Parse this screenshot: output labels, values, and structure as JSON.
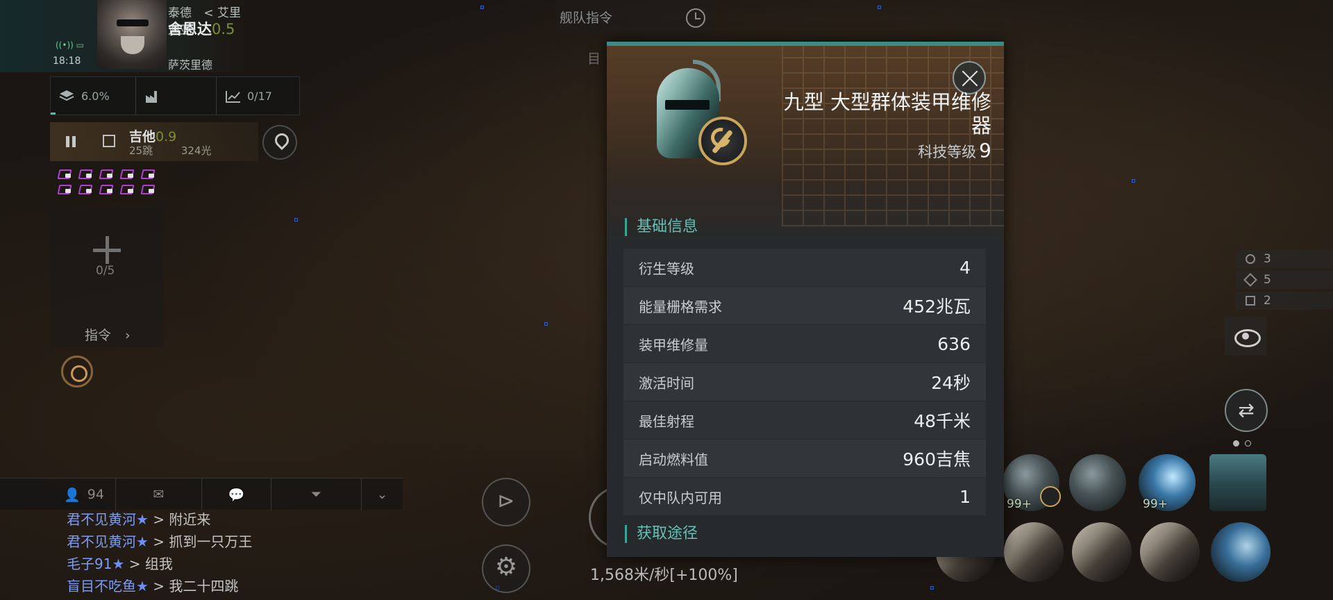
{
  "header": {
    "location_prefix": "泰德",
    "location_region": "< 艾里迪亚",
    "system_name": "舍恩达",
    "system_security": "0.5",
    "constellation": "萨茨里德",
    "clock": "18:18"
  },
  "stats": {
    "cargo_percent": "6.0%",
    "industry_progress": "0/17",
    "cargo_fill": 6.0
  },
  "route": {
    "destination": "吉他",
    "destination_security": "0.9",
    "jumps": "25跳",
    "distance": "324光"
  },
  "fleet": {
    "count": "0/5",
    "command_label": "指令"
  },
  "chat": {
    "member_count": "94",
    "messages": [
      {
        "name": "君不见黄河",
        "star": "★",
        "sep": " > ",
        "text": "附近来"
      },
      {
        "name": "君不见黄河",
        "star": "★",
        "sep": " > ",
        "text": "抓到一只万王"
      },
      {
        "name": "毛子91",
        "star": "★",
        "sep": " > ",
        "text": "组我"
      },
      {
        "name": "盲目不吃鱼",
        "star": "★",
        "sep": " > ",
        "text": "我二十四跳"
      }
    ]
  },
  "top_center": {
    "fleet_command": "舰队指令",
    "target_peek": "目"
  },
  "modal": {
    "title_line1": "九型 大型群体装甲维修",
    "title_line2": "器",
    "tech_label": "科技等级",
    "tech_value": "9",
    "section_basic": "基础信息",
    "section_source": "获取途径",
    "attributes": [
      {
        "label": "衍生等级",
        "value": "4"
      },
      {
        "label": "能量栅格需求",
        "value": "452兆瓦"
      },
      {
        "label": "装甲维修量",
        "value": "636"
      },
      {
        "label": "激活时间",
        "value": "24秒"
      },
      {
        "label": "最佳射程",
        "value": "48千米"
      },
      {
        "label": "启动燃料值",
        "value": "960吉焦"
      },
      {
        "label": "仅中队内可用",
        "value": "1"
      }
    ]
  },
  "right_panel": {
    "stack_counts": [
      "3",
      "5",
      "2"
    ],
    "module_counts": [
      "99+",
      "99+"
    ]
  },
  "ship": {
    "speed": "1,568米/秒[+100%]"
  },
  "colors": {
    "accent_teal": "#3aa594",
    "chat_name_blue": "#7d9bf0",
    "security_green": "#7a8f3a"
  },
  "icons": {
    "module": "helmet-icon",
    "badge": "wrench-icon",
    "close": "close-icon"
  }
}
